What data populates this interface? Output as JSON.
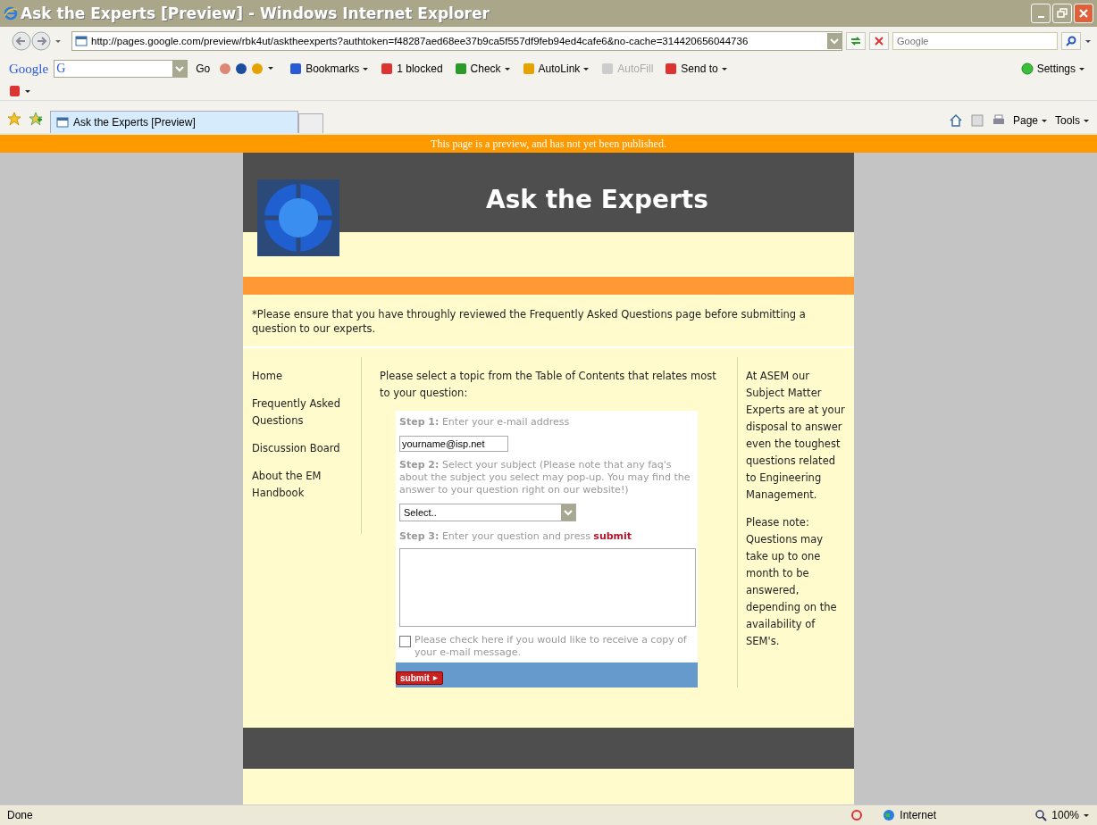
{
  "window": {
    "title": "Ask the Experts [Preview] - Windows Internet Explorer"
  },
  "address_bar": {
    "url": "http://pages.google.com/preview/rbk4ut/asktheexperts?authtoken=f48287aed68ee37b9ca5f557df9feb94ed4cafe6&no-cache=314420656044736"
  },
  "search": {
    "placeholder": "Google"
  },
  "google_logo": "Google",
  "toolbar_search_icon": "G",
  "google_toolbar": [
    {
      "label": "Go",
      "caret": false,
      "disabled": false
    },
    {
      "label": "Bookmarks",
      "caret": true,
      "disabled": false
    },
    {
      "label": "1 blocked",
      "caret": false,
      "disabled": false
    },
    {
      "label": "Check",
      "caret": true,
      "disabled": false
    },
    {
      "label": "AutoLink",
      "caret": true,
      "disabled": false
    },
    {
      "label": "AutoFill",
      "caret": false,
      "disabled": true
    },
    {
      "label": "Send to",
      "caret": true,
      "disabled": false
    }
  ],
  "settings": {
    "label": "Settings"
  },
  "tabs": [
    {
      "label": "Ask the Experts [Preview]",
      "selected": true
    }
  ],
  "command_bar": [
    "Page",
    "Tools"
  ],
  "banner": "This page is a preview, and has not yet been published.",
  "page": {
    "title": "Ask the Experts",
    "notice": "*Please ensure that you have throughly reviewed the Frequently Asked Questions page before submitting a question to our experts.",
    "nav": [
      "Home",
      "Frequently Asked Questions",
      "Discussion Board",
      "About the EM Handbook"
    ],
    "intro": "Please select a topic from the Table of Contents that relates most to your question:",
    "form": {
      "step1": "**Step 1:** Enter your e-mail address",
      "email": "yourname@isp.net",
      "step2": "**Step 2:** Select your subject (Please note that any faq's about the subject you select may pop-up. You may find the answer to your question right on our website!)",
      "select": "Select..",
      "step3": "**Step 3:** Enter your question and press",
      "step3_link": "submit",
      "copy_label": "Please check here if you would like to receive a copy of your e-mail message.",
      "copy_checked": false,
      "submit": "submit"
    },
    "sidebar": [
      "At ASEM our Subject Matter Experts are at your disposal to answer even the toughest questions related to Engineering Management.",
      "Please note: Questions may take up to one month to be answered, depending on the availability of SEM's."
    ]
  },
  "status_bar": {
    "text": "Done",
    "zone": "Internet",
    "zoom": "100%"
  }
}
